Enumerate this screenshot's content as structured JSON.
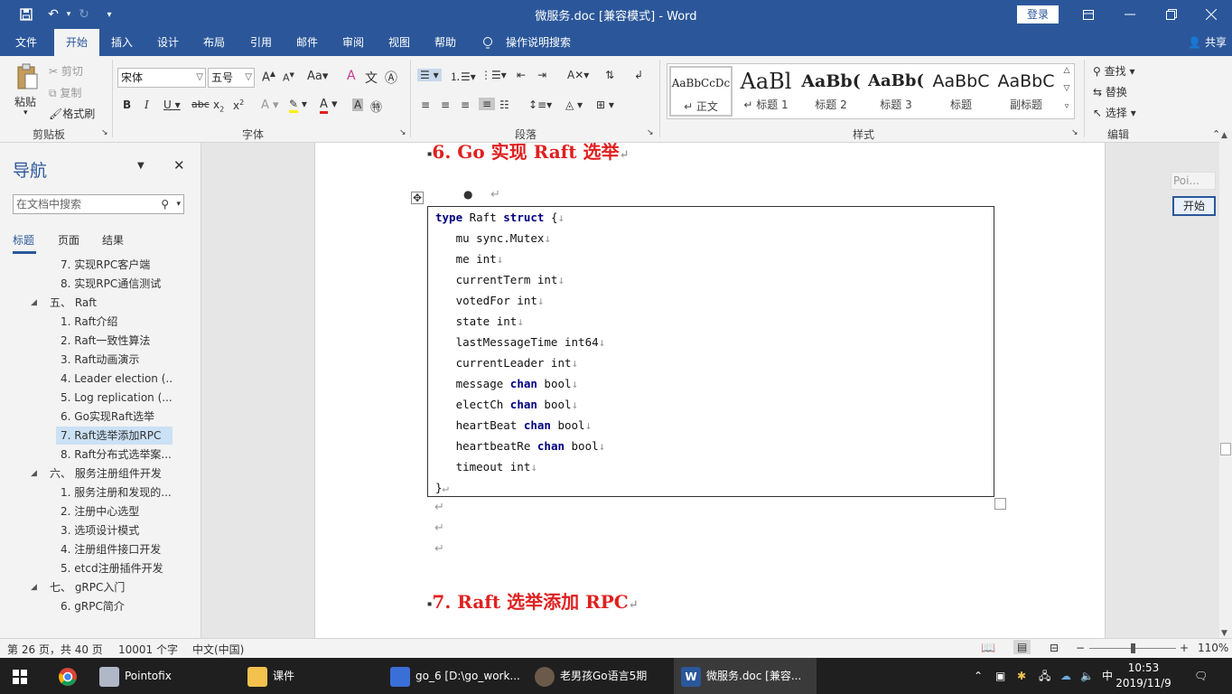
{
  "window": {
    "title": "微服务.doc [兼容模式]  -  Word",
    "login_label": "登录"
  },
  "menu": {
    "tabs": [
      "文件",
      "开始",
      "插入",
      "设计",
      "布局",
      "引用",
      "邮件",
      "审阅",
      "视图",
      "帮助"
    ],
    "active_tab": "开始",
    "tell_me": "操作说明搜索",
    "share": "共享"
  },
  "ribbon": {
    "clipboard": {
      "paste": "粘贴",
      "cut": "剪切",
      "copy": "复制",
      "format_painter": "格式刷",
      "label": "剪贴板"
    },
    "font": {
      "name": "宋体",
      "size": "五号",
      "label": "字体"
    },
    "paragraph": {
      "label": "段落"
    },
    "styles": {
      "label": "样式",
      "items": [
        {
          "preview": "AaBbCcDc",
          "name": "↵ 正文"
        },
        {
          "preview": "AaBl",
          "name": "↵ 标题 1"
        },
        {
          "preview": "AaBb(",
          "name": "标题 2"
        },
        {
          "preview": "AaBb(",
          "name": "标题 3"
        },
        {
          "preview": "AaBbC",
          "name": "标题"
        },
        {
          "preview": "AaBbC",
          "name": "副标题"
        }
      ]
    },
    "editing": {
      "find": "查找",
      "replace": "替换",
      "select": "选择",
      "label": "编辑"
    }
  },
  "nav": {
    "title": "导航",
    "search_placeholder": "在文档中搜索",
    "tabs": [
      "标题",
      "页面",
      "结果"
    ],
    "active_tab": "标题",
    "items": [
      {
        "text": "7. 实现RPC客户端",
        "level": 2
      },
      {
        "text": "8. 实现RPC通信测试",
        "level": 2
      },
      {
        "text": "五、  Raft",
        "level": 1
      },
      {
        "text": "1. Raft介绍",
        "level": 2
      },
      {
        "text": "2. Raft一致性算法",
        "level": 2
      },
      {
        "text": "3. Raft动画演示",
        "level": 2
      },
      {
        "text": "4. Leader election (...",
        "level": 2
      },
      {
        "text": "5. Log replication (...",
        "level": 2
      },
      {
        "text": "6. Go实现Raft选举",
        "level": 2
      },
      {
        "text": "7. Raft选举添加RPC",
        "level": 2,
        "selected": true
      },
      {
        "text": "8. Raft分布式选举案...",
        "level": 2
      },
      {
        "text": "六、  服务注册组件开发",
        "level": 1
      },
      {
        "text": "1. 服务注册和发现的...",
        "level": 2
      },
      {
        "text": "2. 注册中心选型",
        "level": 2
      },
      {
        "text": "3. 选项设计模式",
        "level": 2
      },
      {
        "text": "4. 注册组件接口开发",
        "level": 2
      },
      {
        "text": "5. etcd注册插件开发",
        "level": 2
      },
      {
        "text": "七、  gRPC入门",
        "level": 1
      },
      {
        "text": "6. gRPC简介",
        "level": 2
      }
    ]
  },
  "document": {
    "heading_6": "6.  Go 实现 Raft 选举",
    "heading_7": "7.  Raft 选举添加 RPC",
    "bullet": "●",
    "code": [
      {
        "parts": [
          {
            "kw": "type"
          },
          {
            "t": " Raft "
          },
          {
            "kw": "struct"
          },
          {
            "t": " {"
          }
        ]
      },
      {
        "parts": [
          {
            "t": "   mu sync.Mutex"
          }
        ]
      },
      {
        "parts": [
          {
            "t": "   me int"
          }
        ]
      },
      {
        "parts": [
          {
            "t": "   currentTerm int"
          }
        ]
      },
      {
        "parts": [
          {
            "t": "   votedFor int"
          }
        ]
      },
      {
        "parts": [
          {
            "t": "   state int"
          }
        ]
      },
      {
        "parts": [
          {
            "t": "   lastMessageTime int64"
          }
        ]
      },
      {
        "parts": [
          {
            "t": "   currentLeader int"
          }
        ]
      },
      {
        "parts": [
          {
            "t": "   message "
          },
          {
            "kw": "chan"
          },
          {
            "t": " bool"
          }
        ]
      },
      {
        "parts": [
          {
            "t": "   electCh "
          },
          {
            "kw": "chan"
          },
          {
            "t": " bool"
          }
        ]
      },
      {
        "parts": [
          {
            "t": "   heartBeat "
          },
          {
            "kw": "chan"
          },
          {
            "t": " bool"
          }
        ]
      },
      {
        "parts": [
          {
            "t": "   heartbeatRe "
          },
          {
            "kw": "chan"
          },
          {
            "t": " bool"
          }
        ]
      },
      {
        "parts": [
          {
            "t": "   timeout int"
          }
        ]
      },
      {
        "parts": [
          {
            "t": "}"
          }
        ]
      }
    ]
  },
  "pointofix": {
    "mini": "Poi...",
    "start": "开始"
  },
  "status": {
    "page": "第 26 页，共 40 页",
    "words": "10001 个字",
    "lang": "中文(中国)",
    "zoom": "110%"
  },
  "taskbar": {
    "items": [
      "Pointofix",
      "课件",
      "go_6 [D:\\go_work...",
      "老男孩Go语言5期",
      "微服务.doc [兼容..."
    ],
    "ime": "中",
    "time": "10:53",
    "date": "2019/11/9"
  }
}
